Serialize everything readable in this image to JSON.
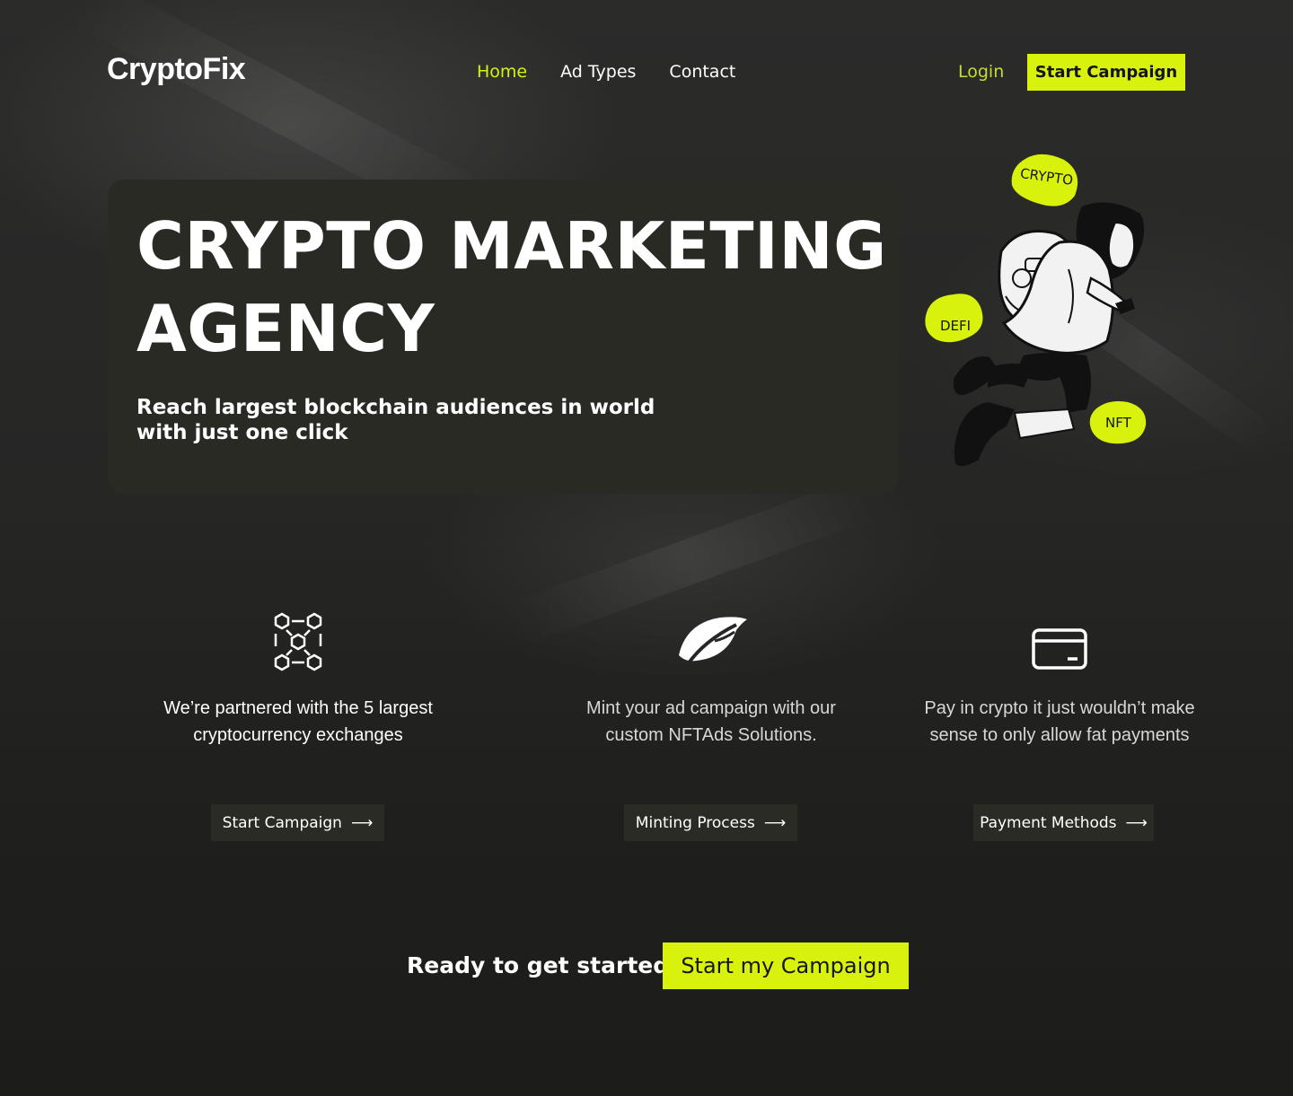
{
  "header": {
    "logo": "CryptoFix",
    "nav": [
      {
        "label": "Home",
        "active": true
      },
      {
        "label": "Ad Types",
        "active": false
      },
      {
        "label": "Contact",
        "active": false
      }
    ],
    "login": "Login",
    "cta": "Start Campaign"
  },
  "hero": {
    "title_line1": "CRYPTO MARKETING",
    "title_line2": "AGENCY",
    "subtitle": "Reach largest blockchain audiences in world with just one click",
    "illustration": {
      "tags": [
        "CRYPTO",
        "DEFI",
        "NFT"
      ]
    }
  },
  "features": [
    {
      "icon": "blockchain-network-icon",
      "text": "We’re partnered with the 5 largest cryptocurrency exchanges",
      "button": "Start Campaign"
    },
    {
      "icon": "leaf-icon",
      "text": "Mint your ad campaign with our custom NFTAds Solutions.",
      "button": "Minting Process"
    },
    {
      "icon": "credit-card-icon",
      "text": "Pay in crypto it just wouldn’t make sense to only allow fat payments",
      "button": "Payment Methods"
    }
  ],
  "cta": {
    "text": "Ready to get started?",
    "button": "Start my Campaign"
  },
  "colors": {
    "accent": "#d9f20d",
    "background": "#1f1f1d",
    "card": "#2a2a25"
  }
}
